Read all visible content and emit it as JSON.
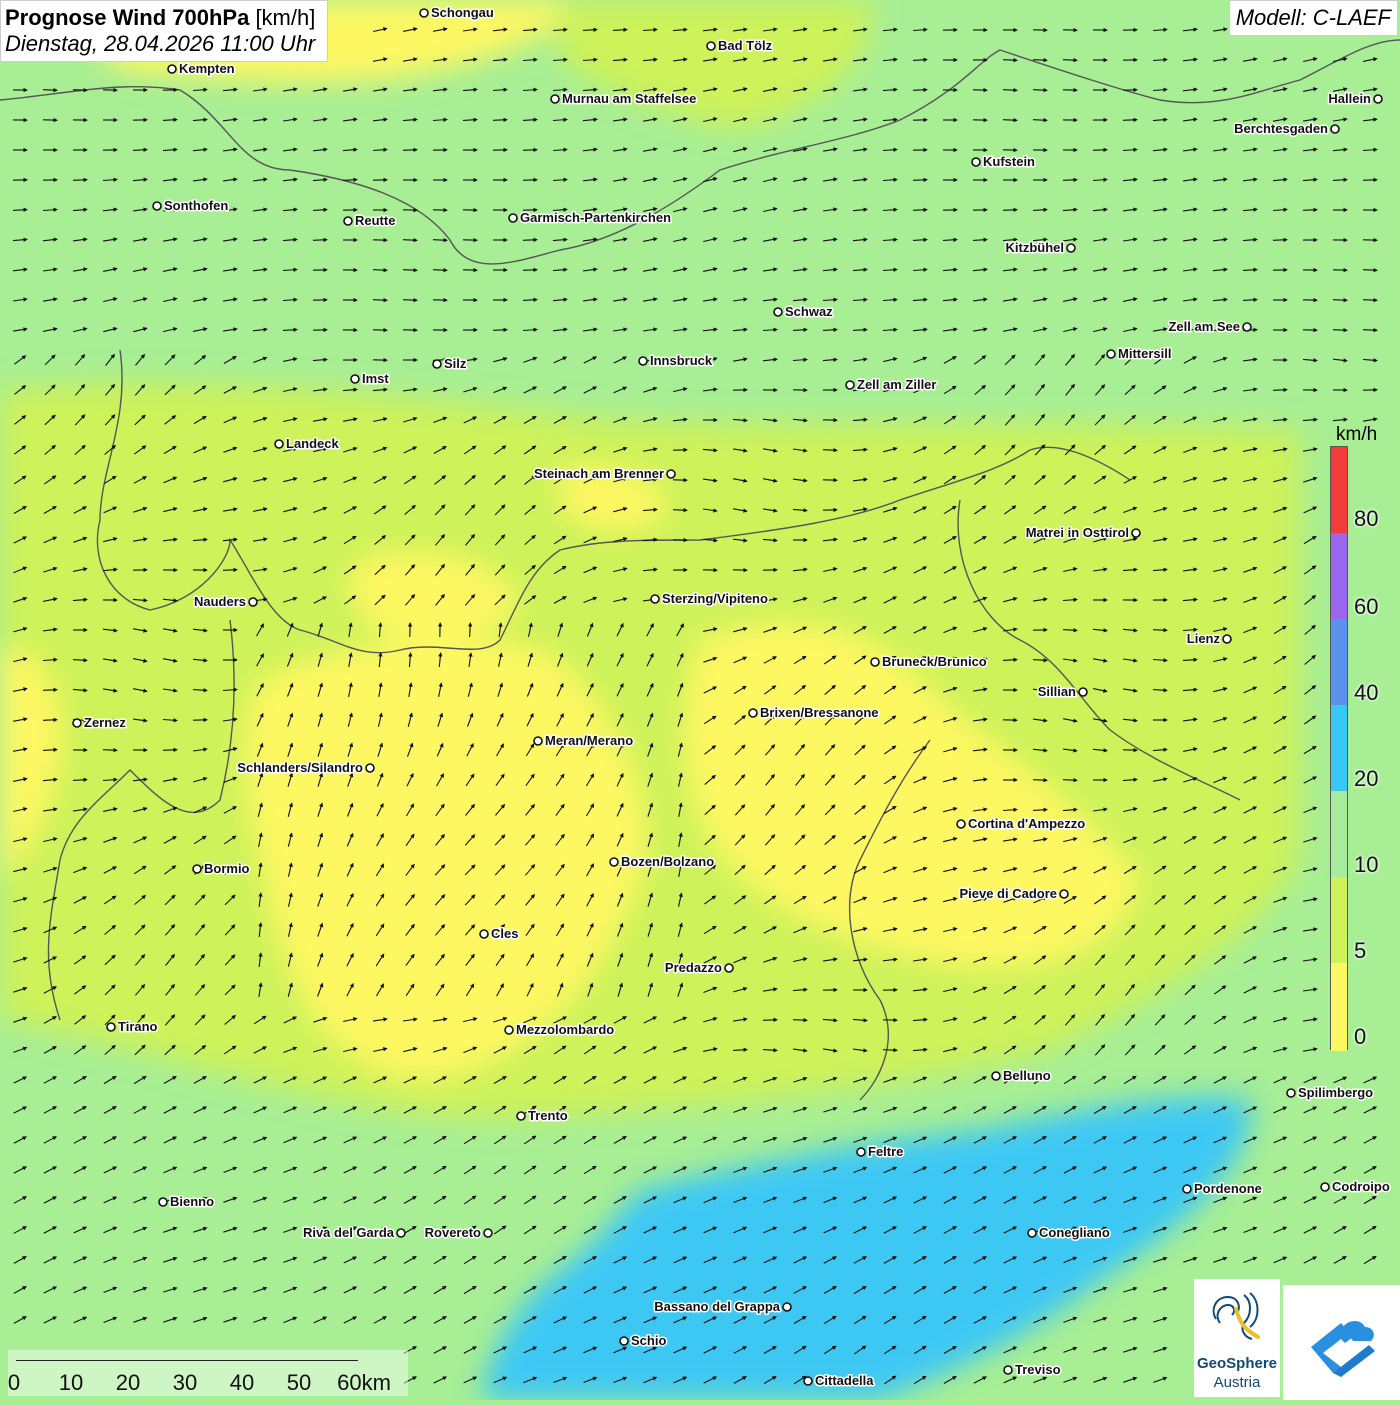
{
  "title": {
    "main": "Prognose Wind 700hPa",
    "unit": "[km/h]",
    "date": "Dienstag, 28.04.2026 11:00 Uhr"
  },
  "model_label": "Modell: C-LAEF",
  "legend": {
    "unit": "km/h",
    "ticks": [
      "80",
      "60",
      "40",
      "20",
      "10",
      "5",
      "0"
    ],
    "colors_bottom_to_top": [
      "#fdf862",
      "#cdf25a",
      "#a6ec9a",
      "#38c8f4",
      "#5c92ee",
      "#9a66ee",
      "#f23c3c"
    ]
  },
  "scale_bar": {
    "labels": [
      "0",
      "10",
      "20",
      "30",
      "40",
      "50",
      "60km"
    ]
  },
  "logo": {
    "name": "GeoSphere",
    "sub": "Austria"
  },
  "wind_field": {
    "prevailing_direction": "southwest to northeast",
    "colors": {
      "calm": "#fdf862",
      "light": "#cdf25a",
      "moderate": "#a6ec9a",
      "fresh": "#3cc8f4"
    }
  },
  "cities": [
    {
      "name": "Schongau",
      "side": "right"
    },
    {
      "name": "Bad Tölz",
      "side": "right"
    },
    {
      "name": "Kempten",
      "side": "right"
    },
    {
      "name": "Murnau am Staffelsee",
      "side": "right"
    },
    {
      "name": "Hallein",
      "side": "left"
    },
    {
      "name": "Berchtesgaden",
      "side": "left"
    },
    {
      "name": "Kufstein",
      "side": "right"
    },
    {
      "name": "Sonthofen",
      "side": "right"
    },
    {
      "name": "Reutte",
      "side": "right"
    },
    {
      "name": "Garmisch-Partenkirchen",
      "side": "right"
    },
    {
      "name": "Kitzbühel",
      "side": "left"
    },
    {
      "name": "Schwaz",
      "side": "right"
    },
    {
      "name": "Zell am See",
      "side": "left"
    },
    {
      "name": "Mittersill",
      "side": "right"
    },
    {
      "name": "Silz",
      "side": "right"
    },
    {
      "name": "Innsbruck",
      "side": "right"
    },
    {
      "name": "Imst",
      "side": "right"
    },
    {
      "name": "Zell am Ziller",
      "side": "right"
    },
    {
      "name": "Landeck",
      "side": "right"
    },
    {
      "name": "Steinach am Brenner",
      "side": "left"
    },
    {
      "name": "Matrei in Osttirol",
      "side": "left"
    },
    {
      "name": "Nauders",
      "side": "left"
    },
    {
      "name": "Sterzing/Vipiteno",
      "side": "right"
    },
    {
      "name": "Lienz",
      "side": "left"
    },
    {
      "name": "Bruneck/Brunico",
      "side": "right"
    },
    {
      "name": "Sillian",
      "side": "left"
    },
    {
      "name": "Brixen/Bressanone",
      "side": "right"
    },
    {
      "name": "Zernez",
      "side": "right"
    },
    {
      "name": "Meran/Merano",
      "side": "right"
    },
    {
      "name": "Schlanders/Silandro",
      "side": "left"
    },
    {
      "name": "Cortina d'Ampezzo",
      "side": "right"
    },
    {
      "name": "Bozen/Bolzano",
      "side": "right"
    },
    {
      "name": "Bormio",
      "side": "right"
    },
    {
      "name": "Pieve di Cadore",
      "side": "left"
    },
    {
      "name": "Cles",
      "side": "right"
    },
    {
      "name": "Predazzo",
      "side": "left"
    },
    {
      "name": "Tirano",
      "side": "right"
    },
    {
      "name": "Mezzolombardo",
      "side": "right"
    },
    {
      "name": "Belluno",
      "side": "right"
    },
    {
      "name": "Spilimbergo",
      "side": "right"
    },
    {
      "name": "Trento",
      "side": "right"
    },
    {
      "name": "Feltre",
      "side": "right"
    },
    {
      "name": "Pordenone",
      "side": "right"
    },
    {
      "name": "Codroipo",
      "side": "right"
    },
    {
      "name": "Bienno",
      "side": "right"
    },
    {
      "name": "Riva del Garda",
      "side": "left"
    },
    {
      "name": "Rovereto",
      "side": "left"
    },
    {
      "name": "Conegliano",
      "side": "right"
    },
    {
      "name": "Bassano del Grappa",
      "side": "left"
    },
    {
      "name": "Schio",
      "side": "right"
    },
    {
      "name": "Treviso",
      "side": "right"
    },
    {
      "name": "Cittadella",
      "side": "right"
    }
  ]
}
